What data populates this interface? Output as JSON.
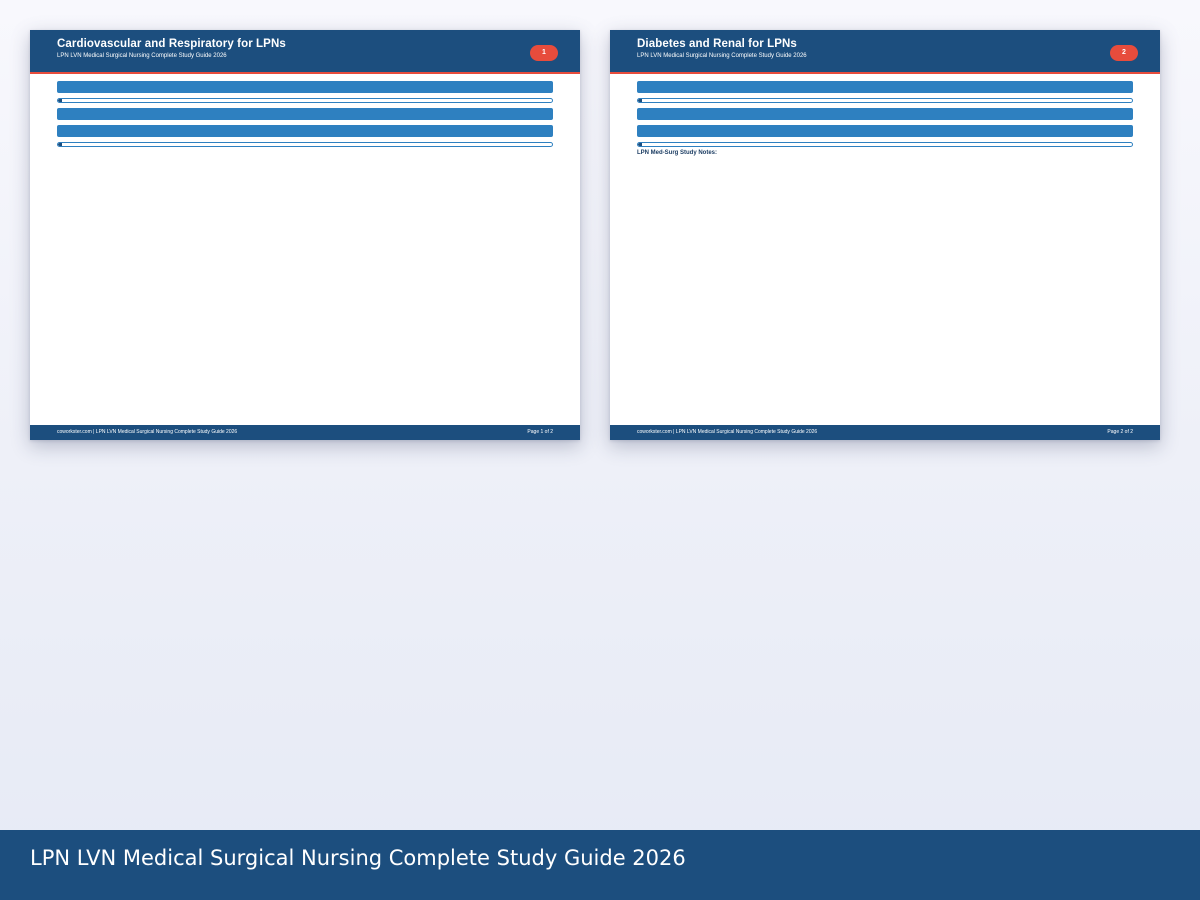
{
  "colors": {
    "header_bg": "#1c4e7e",
    "accent_red": "#e74c3c",
    "bar_blue": "#2e80c0",
    "background": "#eef0f8"
  },
  "pages": [
    {
      "title": "Cardiovascular and Respiratory for LPNs",
      "subtitle": "LPN LVN Medical Surgical Nursing Complete Study Guide 2026",
      "badge": "1",
      "footer_left": "coworkster.com | LPN LVN Medical Surgical Nursing Complete Study Guide 2026",
      "footer_right": "Page 1 of 2",
      "notes_label": ""
    },
    {
      "title": "Diabetes and Renal for LPNs",
      "subtitle": "LPN LVN Medical Surgical Nursing Complete Study Guide 2026",
      "badge": "2",
      "footer_left": "coworkster.com | LPN LVN Medical Surgical Nursing Complete Study Guide 2026",
      "footer_right": "Page 2 of 2",
      "notes_label": "LPN Med-Surg Study Notes:"
    }
  ],
  "progress": {
    "fill_fraction": 0.008
  },
  "banner": {
    "text": "LPN LVN Medical Surgical Nursing Complete Study Guide 2026"
  }
}
